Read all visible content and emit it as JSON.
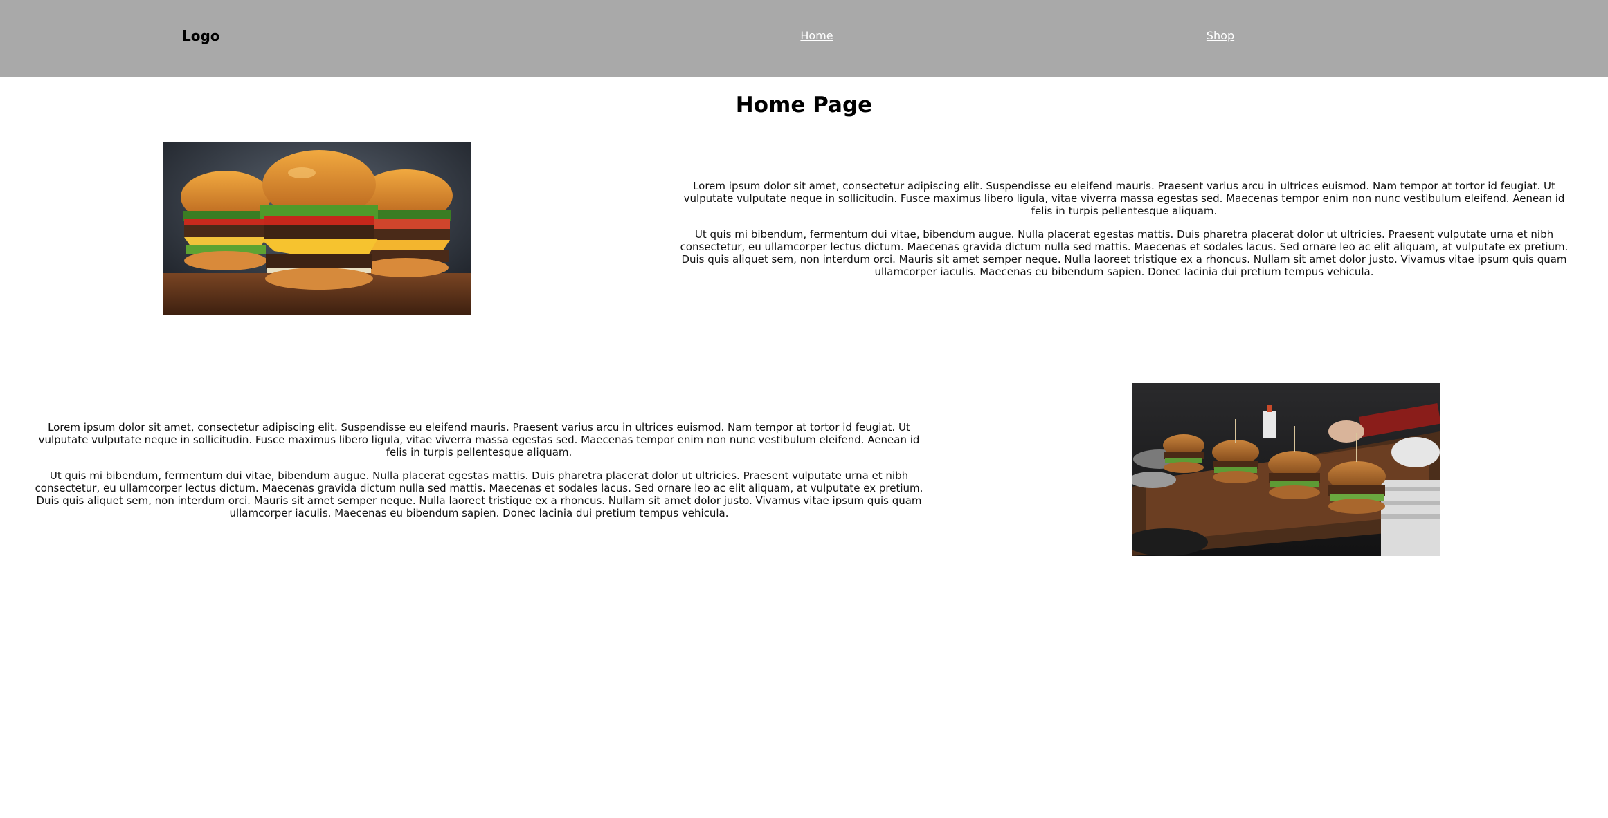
{
  "navbar": {
    "logo": "Logo",
    "links": [
      "Home",
      "Shop"
    ],
    "background": "#a9a9a9"
  },
  "main": {
    "title": "Home Page",
    "section1": {
      "image_alt": "burgers-on-wooden-board",
      "paragraphs": [
        "Lorem ipsum dolor sit amet, consectetur adipiscing elit. Suspendisse eu eleifend mauris. Praesent varius arcu in ultrices euismod. Nam tempor at tortor id feugiat. Ut vulputate vulputate neque in sollicitudin. Fusce maximus libero ligula, vitae viverra massa egestas sed. Maecenas tempor enim non nunc vestibulum eleifend. Aenean id felis in turpis pellentesque aliquam.",
        "Ut quis mi bibendum, fermentum dui vitae, bibendum augue. Nulla placerat egestas mattis. Duis pharetra placerat dolor ut ultricies. Praesent vulputate urna et nibh consectetur, eu ullamcorper lectus dictum. Maecenas gravida dictum nulla sed mattis. Maecenas et sodales lacus. Sed ornare leo ac elit aliquam, at vulputate ex pretium. Duis quis aliquet sem, non interdum orci. Mauris sit amet semper neque. Nulla laoreet tristique ex a rhoncus. Nullam sit amet dolor justo. Vivamus vitae ipsum quis quam ullamcorper iaculis. Maecenas eu bibendum sapien. Donec lacinia dui pretium tempus vehicula."
      ]
    },
    "section2": {
      "image_alt": "burgers-in-kitchen",
      "paragraphs": [
        "Lorem ipsum dolor sit amet, consectetur adipiscing elit. Suspendisse eu eleifend mauris. Praesent varius arcu in ultrices euismod. Nam tempor at tortor id feugiat. Ut vulputate vulputate neque in sollicitudin. Fusce maximus libero ligula, vitae viverra massa egestas sed. Maecenas tempor enim non nunc vestibulum eleifend. Aenean id felis in turpis pellentesque aliquam.",
        "Ut quis mi bibendum, fermentum dui vitae, bibendum augue. Nulla placerat egestas mattis. Duis pharetra placerat dolor ut ultricies. Praesent vulputate urna et nibh consectetur, eu ullamcorper lectus dictum. Maecenas gravida dictum nulla sed mattis. Maecenas et sodales lacus. Sed ornare leo ac elit aliquam, at vulputate ex pretium. Duis quis aliquet sem, non interdum orci. Mauris sit amet semper neque. Nulla laoreet tristique ex a rhoncus. Nullam sit amet dolor justo. Vivamus vitae ipsum quis quam ullamcorper iaculis. Maecenas eu bibendum sapien. Donec lacinia dui pretium tempus vehicula."
      ]
    }
  }
}
